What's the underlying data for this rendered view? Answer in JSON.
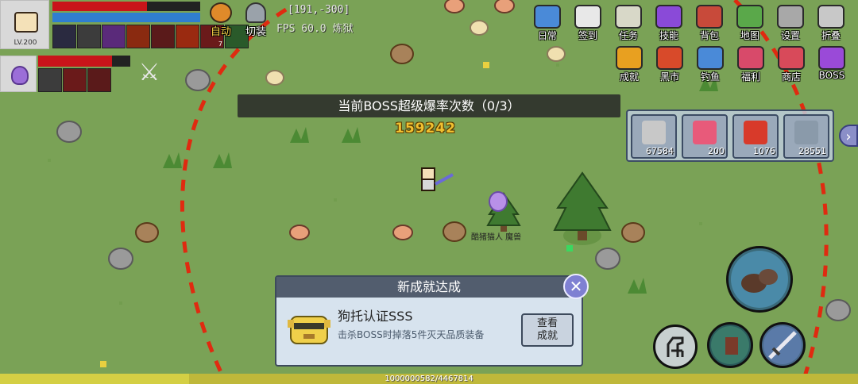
{
  "player": {
    "level": "LV.200",
    "hp_fraction": 0.64,
    "mp_fraction": 1.0,
    "buffs": [
      {
        "icon": "skull-buff-icon",
        "color": "#2a2a40",
        "count": ""
      },
      {
        "icon": "armor-buff-icon",
        "color": "#3c3c3c",
        "count": ""
      },
      {
        "icon": "purple-orb-buff-icon",
        "color": "#5a2a7a",
        "count": ""
      },
      {
        "icon": "fire-buff-icon",
        "color": "#8a2a10",
        "count": ""
      },
      {
        "icon": "rage-buff-icon",
        "color": "#5a1a1a",
        "count": ""
      },
      {
        "icon": "flame-buff-icon",
        "color": "#9a2a10",
        "count": ""
      },
      {
        "icon": "blade-buff-icon",
        "color": "#6a1a1a",
        "count": "7"
      },
      {
        "icon": "shield-buff-icon",
        "color": "#2a5a2a",
        "count": ""
      }
    ]
  },
  "pet": {
    "hp_fraction": 0.8,
    "buffs": [
      {
        "icon": "pet-armor-buff-icon",
        "color": "#3c3c3c"
      },
      {
        "icon": "pet-rage-buff-icon",
        "color": "#6a1a1a"
      },
      {
        "icon": "pet-blade-buff-icon",
        "color": "#5a1a1a"
      }
    ]
  },
  "hud": {
    "auto_label": "自动",
    "switch_label": "切装",
    "coords": "[191,-300]",
    "fps": "FPS 60.0 炼狱"
  },
  "menu_top": [
    {
      "id": "daily",
      "label": "日常",
      "icon": "daily-icon",
      "color": "#4a8ad8"
    },
    {
      "id": "signin",
      "label": "签到",
      "icon": "calendar-icon",
      "color": "#e8e8e8"
    },
    {
      "id": "quest",
      "label": "任务",
      "icon": "scroll-icon",
      "color": "#d8d8c8"
    },
    {
      "id": "skill",
      "label": "技能",
      "icon": "skill-book-icon",
      "color": "#8a4ad8"
    },
    {
      "id": "bag",
      "label": "背包",
      "icon": "backpack-icon",
      "color": "#c84a3a"
    },
    {
      "id": "map",
      "label": "地图",
      "icon": "map-icon",
      "color": "#5aa84a"
    },
    {
      "id": "settings",
      "label": "设置",
      "icon": "gear-icon",
      "color": "#a8a8a8"
    },
    {
      "id": "fold",
      "label": "折叠",
      "icon": "fold-icon",
      "color": "#c8c8c8"
    }
  ],
  "menu_second": [
    {
      "id": "achievement",
      "label": "成就",
      "icon": "trophy-icon",
      "color": "#e8a020"
    },
    {
      "id": "blackmarket",
      "label": "黑市",
      "icon": "crown-icon",
      "color": "#d84a2a"
    },
    {
      "id": "fishing",
      "label": "钓鱼",
      "icon": "fish-icon",
      "color": "#4a8ad8"
    },
    {
      "id": "welfare",
      "label": "福利",
      "icon": "gift-icon",
      "color": "#d84a6a"
    },
    {
      "id": "shop",
      "label": "商店",
      "icon": "shop-icon",
      "color": "#d84a5a"
    },
    {
      "id": "boss",
      "label": "BOSS",
      "icon": "boss-icon",
      "color": "#9a4ad8"
    }
  ],
  "boss_banner": "当前BOSS超级爆率次数（0/3）",
  "damage_number": "159242",
  "items": [
    {
      "icon": "sword-item-icon",
      "count": "67584",
      "color": "#c8c8c8"
    },
    {
      "icon": "pink-crystal-item-icon",
      "count": "200",
      "color": "#e85a7a"
    },
    {
      "icon": "red-potion-item-icon",
      "count": "1076",
      "color": "#d83a2a"
    },
    {
      "icon": "disc-item-icon",
      "count": "28551",
      "color": "#8a9aaa"
    }
  ],
  "expand_label": "›",
  "npc_label": "酷猪猫人 魔兽",
  "achievement": {
    "header": "新成就达成",
    "title": "狗托认证SSS",
    "description": "击杀BOSS时掉落5件灭天品质装备",
    "view_label_1": "查看",
    "view_label_2": "成就",
    "close_label": "✕"
  },
  "exp": {
    "text": "1000000582/4467814",
    "fraction": 0.22
  }
}
